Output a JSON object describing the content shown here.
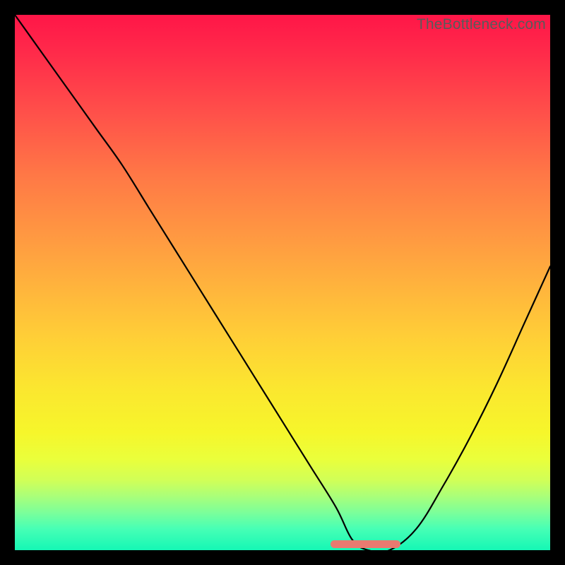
{
  "watermark": "TheBottleneck.com",
  "chart_data": {
    "type": "line",
    "title": "",
    "xlabel": "",
    "ylabel": "",
    "xlim": [
      0,
      100
    ],
    "ylim": [
      0,
      100
    ],
    "grid": false,
    "legend": false,
    "background_gradient": {
      "top": "#ff1648",
      "middle": "#ffce37",
      "bottom": "#15f7b5"
    },
    "series": [
      {
        "name": "bottleneck-curve",
        "color": "#000000",
        "x": [
          0,
          5,
          10,
          15,
          20,
          25,
          30,
          35,
          40,
          45,
          50,
          55,
          60,
          63,
          66,
          70,
          75,
          80,
          85,
          90,
          95,
          100
        ],
        "values": [
          100,
          93,
          86,
          79,
          72,
          64,
          56,
          48,
          40,
          32,
          24,
          16,
          8,
          2,
          0,
          0,
          4,
          12,
          21,
          31,
          42,
          53
        ]
      }
    ],
    "optimal_range": {
      "x_start": 59,
      "x_end": 72
    },
    "marker_color": "#e87a70"
  }
}
